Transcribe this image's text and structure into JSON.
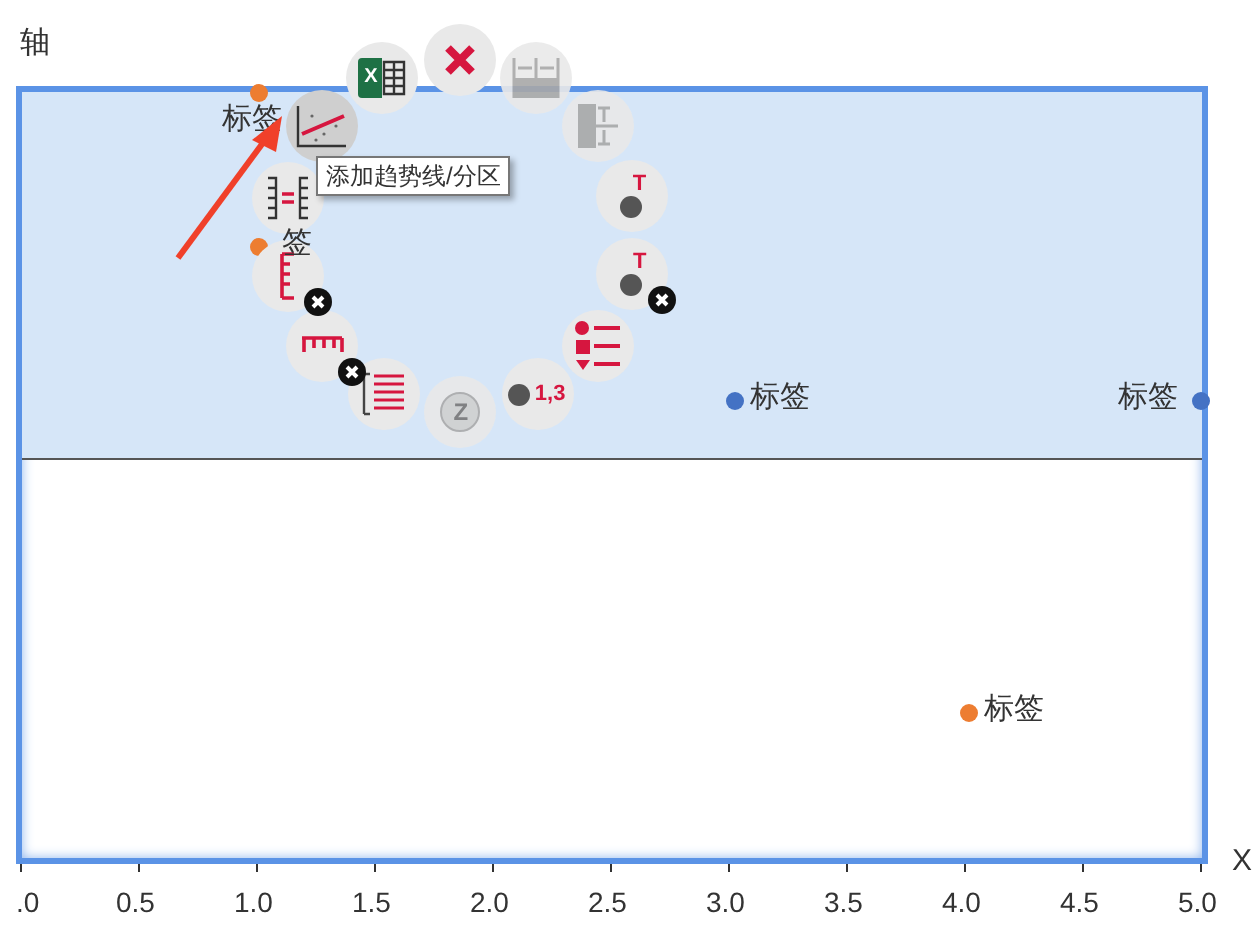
{
  "y_axis": {
    "title": "轴"
  },
  "x_axis": {
    "title": "X",
    "ticks": [
      ".0",
      "0.5",
      "1.0",
      "1.5",
      "2.0",
      "2.5",
      "3.0",
      "3.5",
      "4.0",
      "4.5",
      "5.0"
    ]
  },
  "points": [
    {
      "label": "标签",
      "color": "#ed7d31"
    },
    {
      "label": "签",
      "color": "#ed7d31"
    },
    {
      "label": "标签",
      "color": "#4472c4"
    },
    {
      "label": "标签",
      "color": "#4472c4"
    },
    {
      "label": "标签",
      "color": "#ed7d31"
    }
  ],
  "menu": {
    "items": [
      {
        "kind": "excel",
        "glyph": "X",
        "disabled": false,
        "selected": false
      },
      {
        "kind": "close",
        "disabled": false,
        "selected": false
      },
      {
        "kind": "columns",
        "disabled": true,
        "selected": false
      },
      {
        "kind": "rows",
        "disabled": true,
        "selected": false
      },
      {
        "kind": "point-label",
        "glyph": "T",
        "disabled": false,
        "selected": false
      },
      {
        "kind": "point-label-remove",
        "glyph": "T",
        "disabled": false,
        "selected": false
      },
      {
        "kind": "legend",
        "disabled": false,
        "selected": false
      },
      {
        "kind": "data-labels",
        "glyph": "1,3",
        "disabled": false,
        "selected": false
      },
      {
        "kind": "zoom",
        "glyph": "Z",
        "disabled": true,
        "selected": false
      },
      {
        "kind": "gridlines",
        "disabled": false,
        "selected": false
      },
      {
        "kind": "ticks-remove",
        "disabled": false,
        "selected": false
      },
      {
        "kind": "axis-remove",
        "disabled": false,
        "selected": false
      },
      {
        "kind": "axis-scale",
        "disabled": false,
        "selected": false
      },
      {
        "kind": "trendline",
        "disabled": false,
        "selected": true
      }
    ],
    "tooltip": "添加趋势线/分区"
  }
}
